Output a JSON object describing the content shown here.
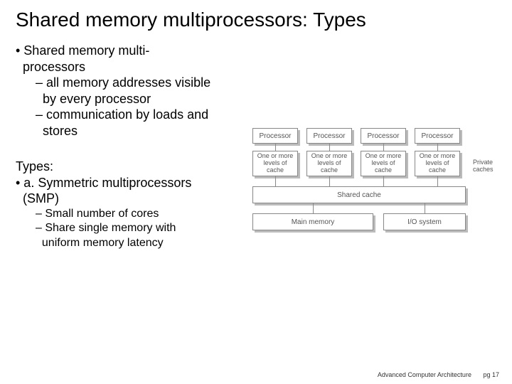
{
  "title": "Shared memory multiprocessors: Types",
  "bullets": {
    "b1": "• Shared memory multi-processors",
    "b1a": "– all memory addresses visible by every processor",
    "b1b": "– communication by loads and stores",
    "types_label": "Types:",
    "b2": "• a. Symmetric multiprocessors (SMP)",
    "b2a": "– Small number of cores",
    "b2b": "– Share single memory with uniform memory latency"
  },
  "diagram": {
    "processor": "Processor",
    "cache": "One or more levels of cache",
    "private_caches": "Private caches",
    "shared_cache": "Shared cache",
    "main_memory": "Main memory",
    "io_system": "I/O system"
  },
  "footer": {
    "course": "Advanced Computer Architecture",
    "page": "pg 17"
  },
  "chart_data": {
    "type": "diagram",
    "description": "SMP block diagram",
    "processors": 4,
    "each_processor_has": "One or more levels of private cache",
    "shared_layers": [
      "Shared cache",
      "Main memory",
      "I/O system"
    ],
    "side_label": "Private caches"
  }
}
